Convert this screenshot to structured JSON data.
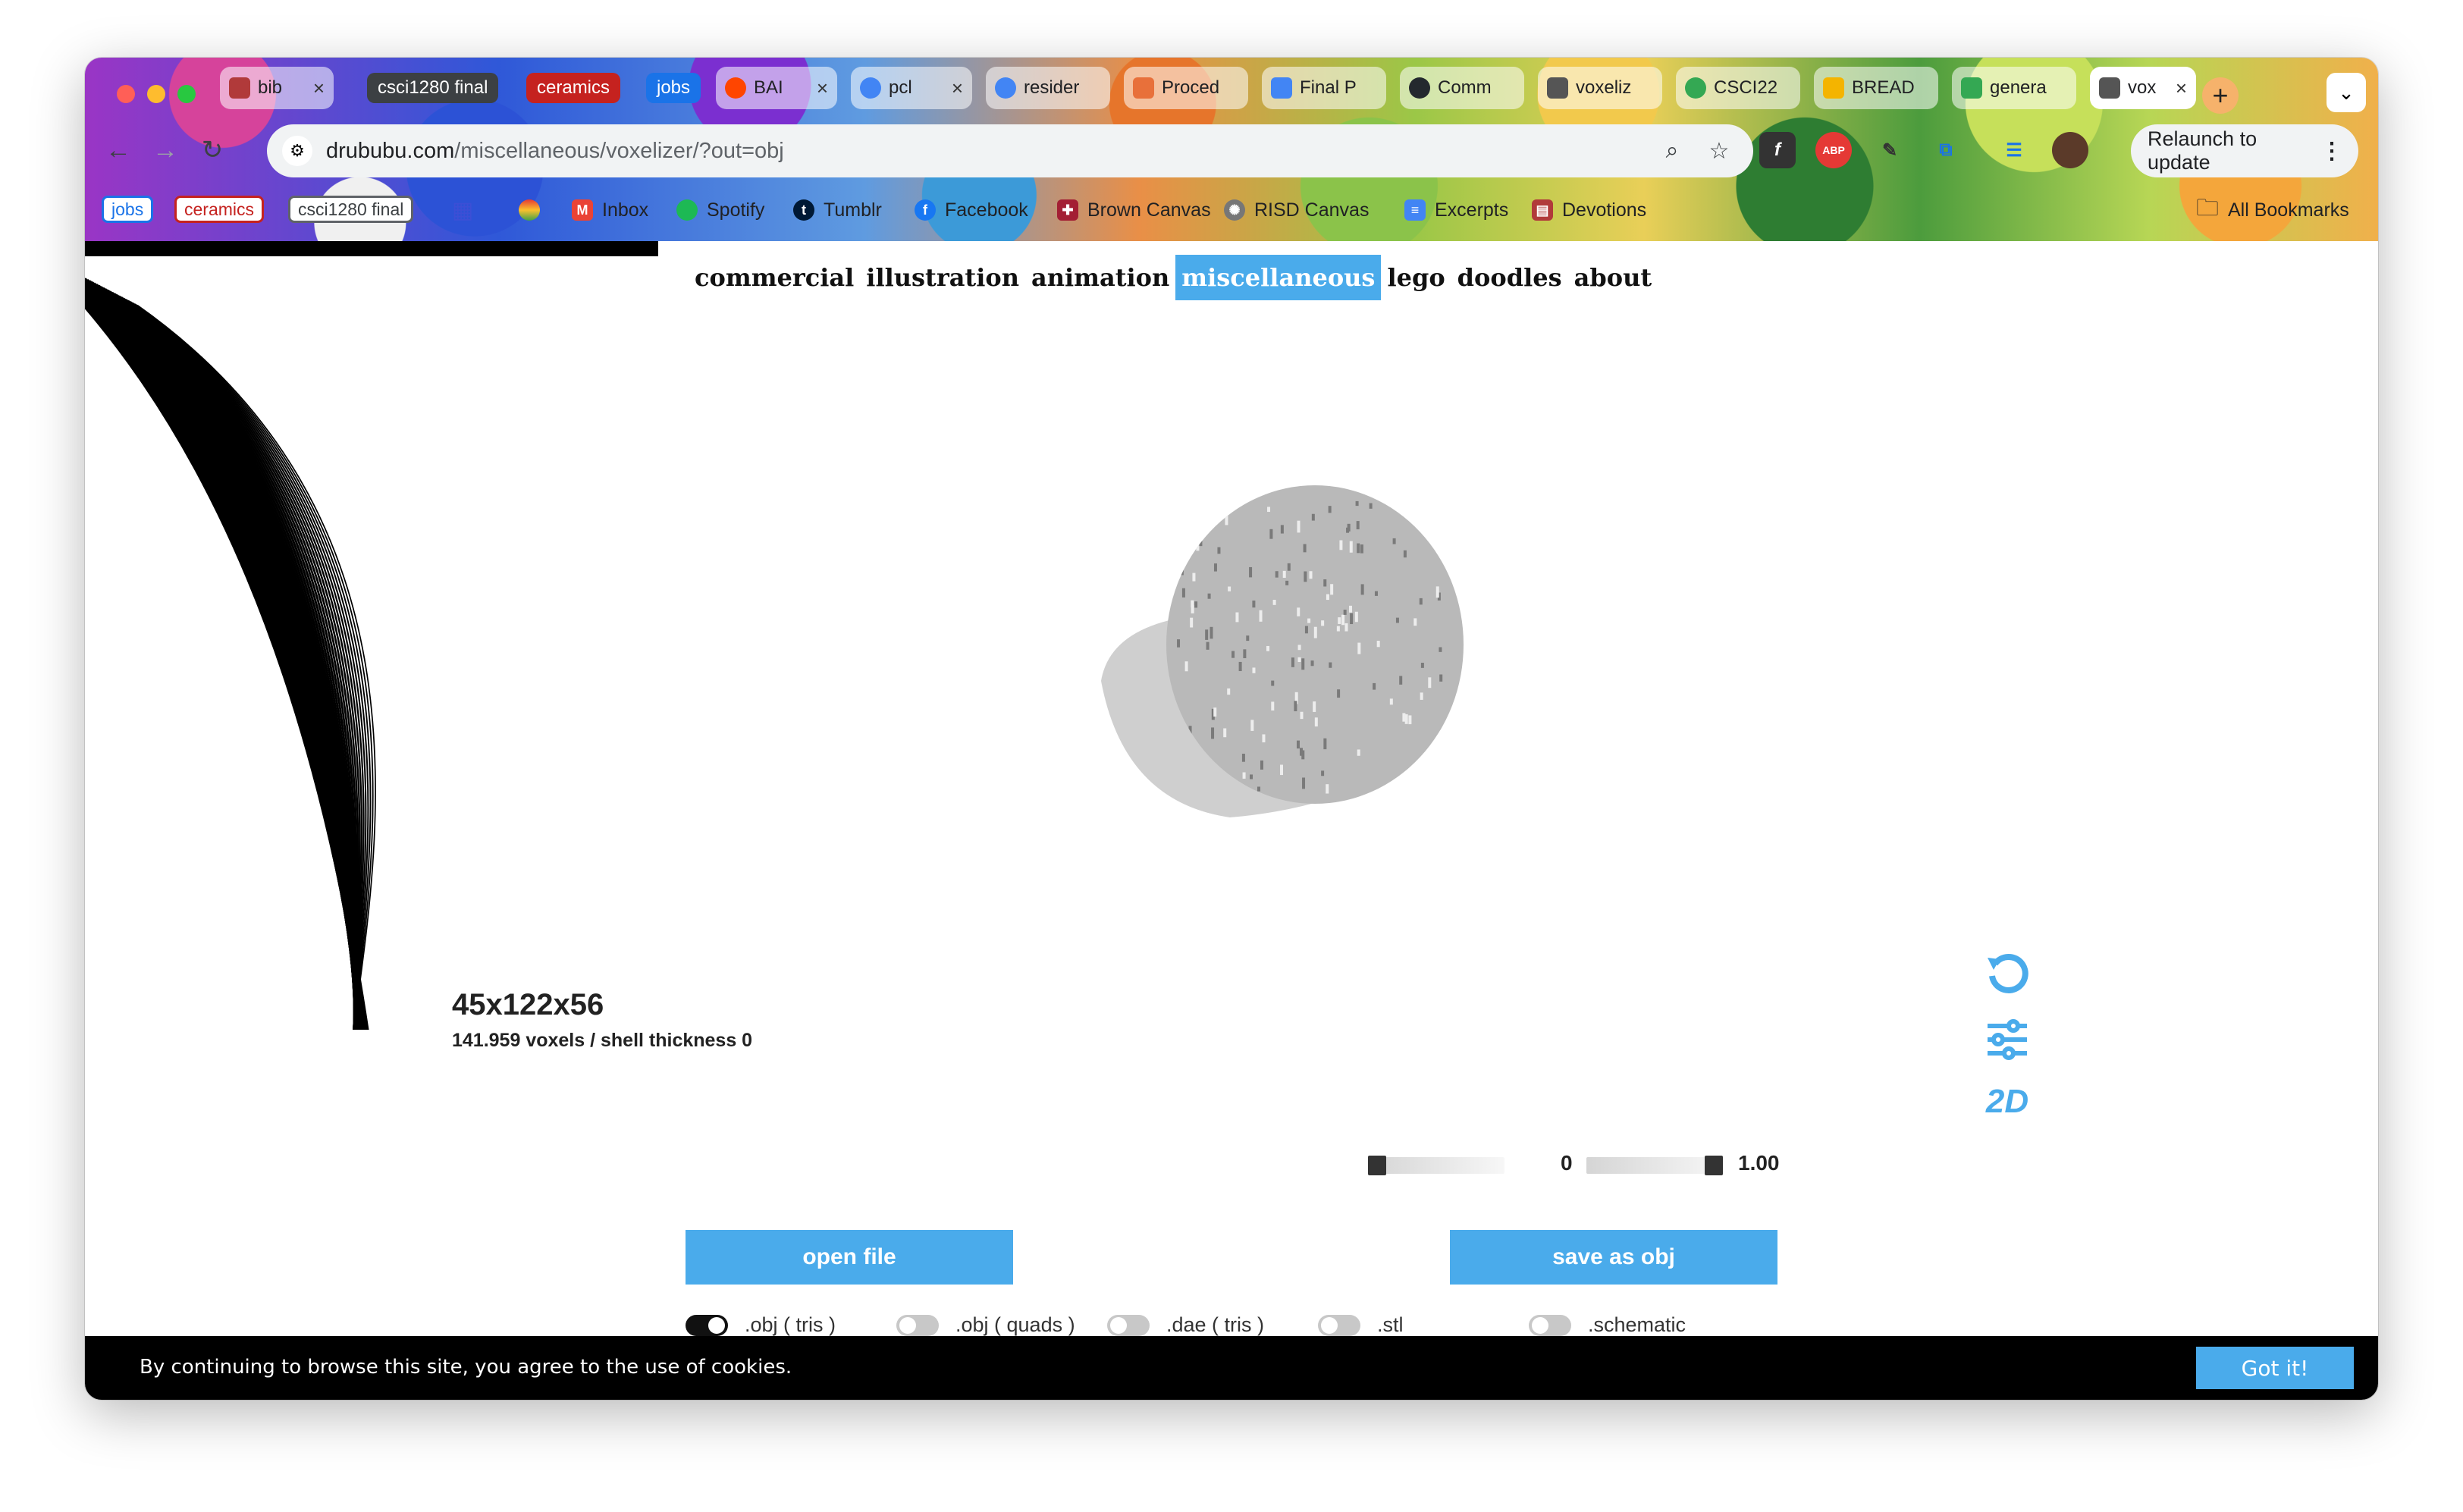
{
  "browser": {
    "tabs": [
      {
        "label": "bib",
        "kind": "page",
        "favicon_color": "#b13a3a",
        "closable": true
      },
      {
        "label": "csci1280 final",
        "kind": "group",
        "color": "#3c4043"
      },
      {
        "label": "ceramics",
        "kind": "group",
        "color": "#c5221f"
      },
      {
        "label": "jobs",
        "kind": "group",
        "color": "#1a73e8"
      },
      {
        "label": "BAI",
        "kind": "page",
        "favicon_color": "#ff4500",
        "closable": true
      },
      {
        "label": "pcl",
        "kind": "page",
        "favicon_color": "#4285f4",
        "closable": true
      },
      {
        "label": "resider",
        "kind": "page",
        "favicon_color": "#4285f4",
        "closable": false
      },
      {
        "label": "Proced",
        "kind": "page",
        "favicon_color": "#e8703a",
        "closable": false
      },
      {
        "label": "Final P",
        "kind": "page",
        "favicon_color": "#4285f4",
        "closable": false
      },
      {
        "label": "Comm",
        "kind": "page",
        "favicon_color": "#24292e",
        "closable": false
      },
      {
        "label": "voxeliz",
        "kind": "page",
        "favicon_color": "#555555",
        "closable": false
      },
      {
        "label": "CSCI22",
        "kind": "page",
        "favicon_color": "#34a853",
        "closable": false
      },
      {
        "label": "BREAD",
        "kind": "page",
        "favicon_color": "#f4b400",
        "closable": false
      },
      {
        "label": "genera",
        "kind": "page",
        "favicon_color": "#34a853",
        "closable": false
      },
      {
        "label": "vox",
        "kind": "page",
        "favicon_color": "#555555",
        "closable": true,
        "active": true
      }
    ],
    "new_tab_label": "+",
    "tab_search_label": "⌄",
    "address": {
      "domain": "drububu.com",
      "path": "/miscellaneous/voxelizer/?out=obj"
    },
    "relaunch_label": "Relaunch to update",
    "bookmarks": [
      {
        "label": "jobs",
        "kind": "chip",
        "color": "#1a73e8"
      },
      {
        "label": "ceramics",
        "kind": "chip",
        "color": "#c5221f"
      },
      {
        "label": "csci1280 final",
        "kind": "chip",
        "color": "#5f6368"
      },
      {
        "label": "",
        "kind": "apps"
      },
      {
        "label": "",
        "kind": "icon"
      },
      {
        "label": "Inbox",
        "kind": "link",
        "icon": "gmail-icon"
      },
      {
        "label": "Spotify",
        "kind": "link",
        "icon": "spotify-icon"
      },
      {
        "label": "Tumblr",
        "kind": "link",
        "icon": "tumblr-icon"
      },
      {
        "label": "Facebook",
        "kind": "link",
        "icon": "facebook-icon"
      },
      {
        "label": "Brown Canvas",
        "kind": "link",
        "icon": "brown-shield-icon"
      },
      {
        "label": "RISD Canvas",
        "kind": "link",
        "icon": "canvas-icon"
      },
      {
        "label": "Excerpts",
        "kind": "link",
        "icon": "docs-icon"
      },
      {
        "label": "Devotions",
        "kind": "link",
        "icon": "book-icon"
      }
    ],
    "all_bookmarks_label": "All Bookmarks"
  },
  "site": {
    "nav": [
      {
        "label": "commercial",
        "active": false
      },
      {
        "label": "illustration",
        "active": false
      },
      {
        "label": "animation",
        "active": false
      },
      {
        "label": "miscellaneous",
        "active": true
      },
      {
        "label": "lego",
        "active": false
      },
      {
        "label": "doodles",
        "active": false
      },
      {
        "label": "about",
        "active": false
      }
    ],
    "accent": "#4aabeb",
    "dimensions": "45x122x56",
    "voxel_info": "141.959 voxels / shell thickness 0",
    "slider_left": {
      "value_label": "0",
      "level": 0
    },
    "slider_right": {
      "value_label": "1.00",
      "level": 1.0
    },
    "open_file_label": "open file",
    "save_label": "save as obj",
    "formats": [
      {
        "label": ".obj ( tris )",
        "on": true
      },
      {
        "label": ".obj ( quads )",
        "on": false
      },
      {
        "label": ".dae ( tris )",
        "on": false
      },
      {
        "label": ".stl",
        "on": false
      },
      {
        "label": ".schematic",
        "on": false
      }
    ],
    "side_icons": [
      "rotate-icon",
      "settings-sliders-icon",
      "2d-icon"
    ],
    "side_2d_label": "2D"
  },
  "cookie": {
    "message": "By continuing to browse this site, you agree to the use of cookies.",
    "accept_label": "Got it!"
  }
}
